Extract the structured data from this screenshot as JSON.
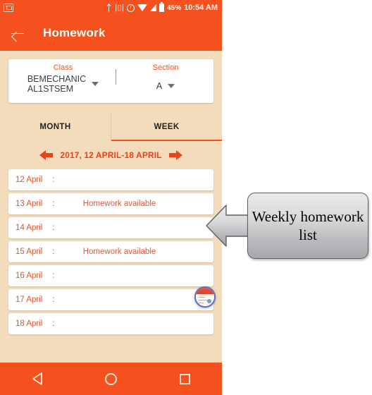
{
  "status_bar": {
    "left_icon": "mail-icon",
    "icons": [
      "bluetooth-icon",
      "vibrate-icon",
      "alarm-icon",
      "wifi-icon",
      "signal-icon",
      "battery-icon"
    ],
    "battery_percent": "45%",
    "clock": "10:54 AM"
  },
  "app_bar": {
    "back_icon": "back-arrow-icon",
    "title": "Homework"
  },
  "selector": {
    "class_label": "Class",
    "class_value": "BEMECHANICAL1STSEM",
    "class_value_line1": "BEMECHANIC",
    "class_value_line2": "AL1STSEM",
    "section_label": "Section",
    "section_value": "A"
  },
  "tabs": [
    {
      "label": "MONTH",
      "active": false
    },
    {
      "label": "WEEK",
      "active": true
    }
  ],
  "week_nav": {
    "prev_icon": "arrow-left-icon",
    "next_icon": "arrow-right-icon",
    "range": "2017, 12 APRIL-18 APRIL"
  },
  "homework_rows": [
    {
      "date": "12 April",
      "separator": ":",
      "status": ""
    },
    {
      "date": "13 April",
      "separator": ":",
      "status": "Homework available"
    },
    {
      "date": "14 April",
      "separator": ":",
      "status": ""
    },
    {
      "date": "15 April",
      "separator": ":",
      "status": "Homework available"
    },
    {
      "date": "16 April",
      "separator": ":",
      "status": ""
    },
    {
      "date": "17 April",
      "separator": ":",
      "status": ""
    },
    {
      "date": "18 April",
      "separator": ":",
      "status": ""
    }
  ],
  "float_badge": {
    "icon": "calendar-thumbnail-icon"
  },
  "nav_bar": {
    "back": "back-triangle-icon",
    "home": "home-circle-icon",
    "recents": "recents-square-icon"
  },
  "callout": {
    "text": "Weekly homework list",
    "arrow_icon": "arrow-left-callout-icon"
  },
  "colors": {
    "accent": "#f4511e",
    "page_bg": "#f3dcbb",
    "card": "#ffffff",
    "text_orange": "#e0522e",
    "outer_bg": "#ffffff"
  }
}
